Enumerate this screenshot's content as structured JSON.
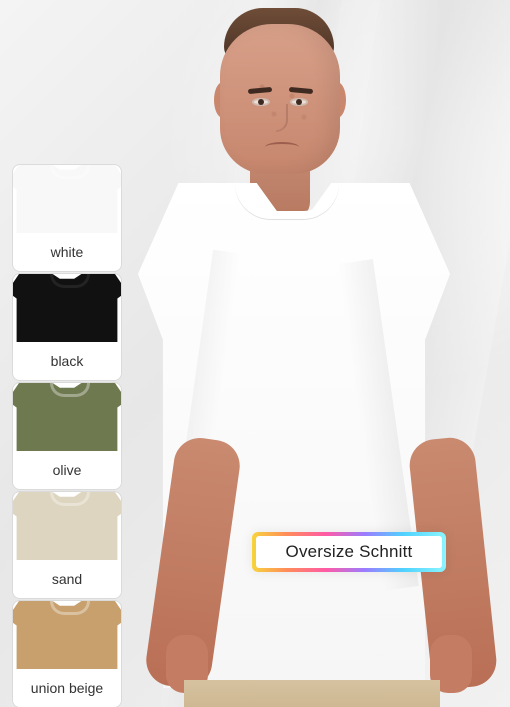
{
  "swatches": [
    {
      "label": "white",
      "color": "#f8f8f8"
    },
    {
      "label": "black",
      "color": "#111111"
    },
    {
      "label": "olive",
      "color": "#6f7950"
    },
    {
      "label": "sand",
      "color": "#ddd5bf"
    },
    {
      "label": "union beige",
      "color": "#c7a06d"
    }
  ],
  "callout": {
    "text": "Oversize Schnitt"
  }
}
